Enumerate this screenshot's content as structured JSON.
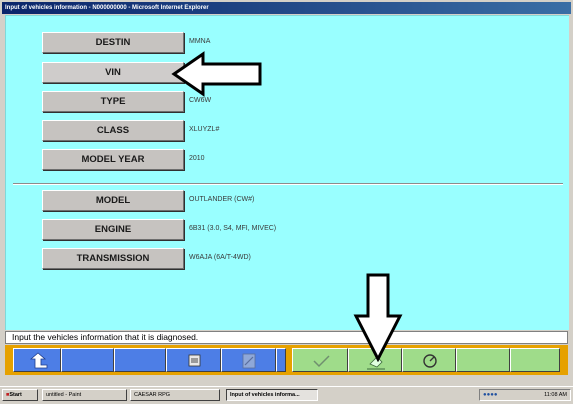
{
  "window": {
    "title": "Input of vehicles information - N000000000 - Microsoft Internet Explorer"
  },
  "fields": [
    {
      "label": "DESTIN",
      "value": "MMNA"
    },
    {
      "label": "VIN",
      "value": ""
    },
    {
      "label": "TYPE",
      "value": "CW6W"
    },
    {
      "label": "CLASS",
      "value": "XLUYZL#"
    },
    {
      "label": "MODEL YEAR",
      "value": "2010"
    },
    {
      "label": "MODEL",
      "value": "OUTLANDER (CW#)"
    },
    {
      "label": "ENGINE",
      "value": "6B31 (3.0, S4, MFI, MIVEC)"
    },
    {
      "label": "TRANSMISSION",
      "value": "W6AJA (6A/T-4WD)"
    }
  ],
  "status": {
    "message": "Input the vehicles information that it is diagnosed."
  },
  "toolbar": {
    "icons": [
      "return-icon",
      "print-icon",
      "note-icon",
      "checkmark-icon",
      "eraser-icon",
      "gauge-icon"
    ]
  },
  "taskbar": {
    "start": "Start",
    "tasks": [
      "untitled - Paint",
      "CAESAR RPG",
      "Input of vehicles informa..."
    ],
    "clock": "11:08 AM"
  },
  "colors": {
    "content_bg": "#99ffff",
    "toolbar_bg": "#e6a100",
    "button_blue": "#4d7ee6",
    "button_green": "#9fdc8a",
    "titlebar": "#0a246a"
  }
}
